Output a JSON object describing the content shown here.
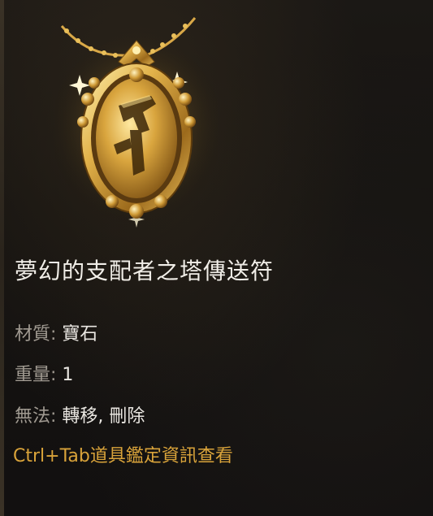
{
  "item": {
    "name": "夢幻的支配者之塔傳送符",
    "icon": "golden-amulet-icon",
    "colors": {
      "name": "#f1eee8",
      "label": "#a09a91",
      "value": "#e9e6e1",
      "hint": "#d9a33a",
      "gold": "#d8a640"
    }
  },
  "attributes": {
    "material": {
      "label": "材質:",
      "value": "寶石"
    },
    "weight": {
      "label": "重量:",
      "value": "1"
    },
    "restriction": {
      "label": "無法:",
      "value": "轉移, 刪除"
    }
  },
  "hint": "Ctrl+Tab道具鑑定資訊查看"
}
